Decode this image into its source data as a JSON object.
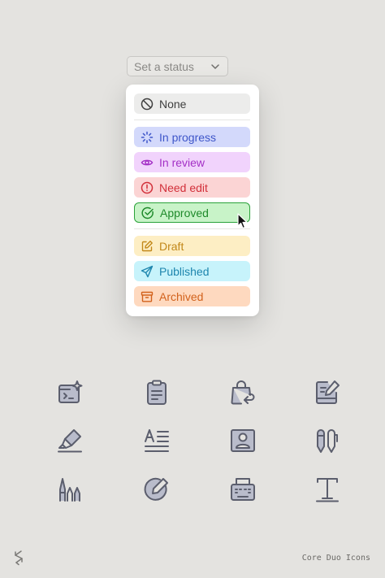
{
  "select": {
    "placeholder": "Set a status",
    "icon": "chevron-down-icon"
  },
  "menu": {
    "items": [
      {
        "label": "None",
        "icon": "ban-icon",
        "bg": "#ececeb",
        "fg": "#3f3f3f",
        "border": ""
      },
      {
        "label": "In progress",
        "icon": "loader-icon",
        "bg": "#d3d9fb",
        "fg": "#3e56c9",
        "border": ""
      },
      {
        "label": "In review",
        "icon": "eye-icon",
        "bg": "#f1d3fc",
        "fg": "#a430c6",
        "border": ""
      },
      {
        "label": "Need edit",
        "icon": "alert-circle-icon",
        "bg": "#fbd4d4",
        "fg": "#d2303a",
        "border": ""
      },
      {
        "label": "Approved",
        "icon": "check-circle-icon",
        "bg": "#c8f3c8",
        "fg": "#1f8a2b",
        "border": "#2aa23a",
        "selected": true
      },
      {
        "label": "Draft",
        "icon": "edit-note-icon",
        "bg": "#fdeec4",
        "fg": "#c2881a",
        "border": ""
      },
      {
        "label": "Published",
        "icon": "send-icon",
        "bg": "#c7f3fb",
        "fg": "#1e86ae",
        "border": ""
      },
      {
        "label": "Archived",
        "icon": "archive-box-icon",
        "bg": "#fed9bf",
        "fg": "#d2621c",
        "border": ""
      }
    ]
  },
  "icon_grid": [
    "ai-terminal-icon",
    "clipboard-icon",
    "bag-return-icon",
    "note-edit-icon",
    "highlighter-icon",
    "text-align-icon",
    "contact-card-icon",
    "pens-icon",
    "markers-icon",
    "edit-circle-icon",
    "typewriter-icon",
    "text-type-icon"
  ],
  "colors": {
    "icon_stroke": "#5b5e6d",
    "icon_fill": "#b9bccb",
    "background": "#e4e3e0"
  },
  "footer": {
    "logo": "core-logo-icon",
    "text": "Core Duo Icons"
  }
}
